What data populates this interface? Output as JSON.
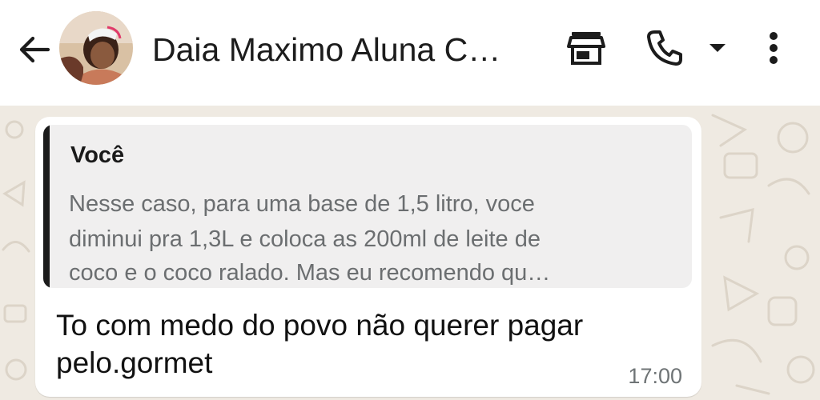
{
  "header": {
    "contact_name": "Daia Maximo Aluna C…",
    "icons": [
      "back-arrow-icon",
      "store-icon",
      "phone-icon",
      "dropdown-caret-icon",
      "more-vert-icon"
    ]
  },
  "message": {
    "quote": {
      "author": "Você",
      "lines": [
        "Nesse caso, para uma base de 1,5 litro, voce",
        "diminui pra 1,3L e coloca as 200ml de leite de",
        "coco e o coco ralado. Mas eu recomendo qu…"
      ]
    },
    "text_lines": [
      "To com medo do povo não querer pagar",
      "pelo.gormet"
    ],
    "time": "17:00"
  },
  "colors": {
    "header_bg": "#ffffff",
    "chat_bg": "#efeae2",
    "bubble_bg": "#ffffff",
    "quote_bg": "#f0efef",
    "quote_bar": "#1b1b1b"
  }
}
